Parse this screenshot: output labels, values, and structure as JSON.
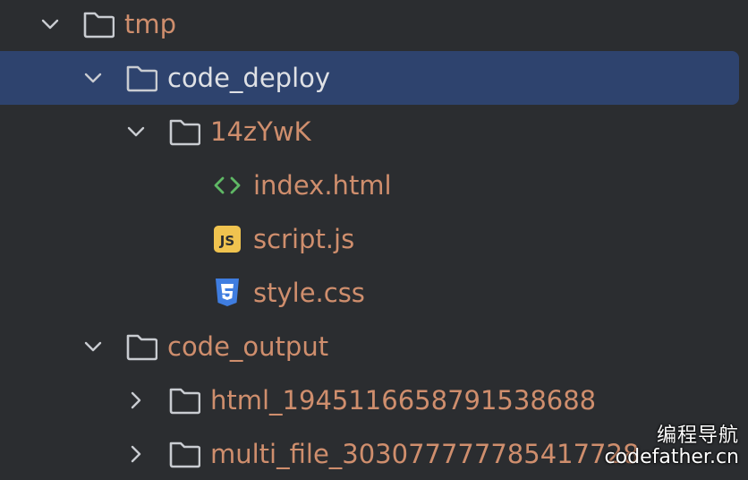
{
  "tree": {
    "items": [
      {
        "label": "tmp",
        "kind": "folder",
        "expanded": true
      },
      {
        "label": "code_deploy",
        "kind": "folder",
        "expanded": true,
        "selected": true
      },
      {
        "label": "14zYwK",
        "kind": "folder",
        "expanded": true
      },
      {
        "label": "index.html",
        "kind": "html-file"
      },
      {
        "label": "script.js",
        "kind": "js-file"
      },
      {
        "label": "style.css",
        "kind": "css-file"
      },
      {
        "label": "code_output",
        "kind": "folder",
        "expanded": true
      },
      {
        "label": "html_1945116658791538688",
        "kind": "folder",
        "expanded": false
      },
      {
        "label": "multi_file_303077777785417728",
        "kind": "folder",
        "expanded": false
      }
    ]
  },
  "icons": {
    "html": "code-brackets-icon",
    "js": "js-file-icon",
    "js_text": "JS",
    "css": "css-shield-icon"
  },
  "colors": {
    "background": "#2b2d30",
    "selection": "#2e436e",
    "orange_text": "#cf8e6d",
    "white_text": "#dfe1e5",
    "html_icon": "#5fb865",
    "js_icon": "#f0c34f",
    "css_icon": "#3f7de0"
  },
  "watermark": {
    "line1": "编程导航",
    "line2": "codefather.cn"
  }
}
